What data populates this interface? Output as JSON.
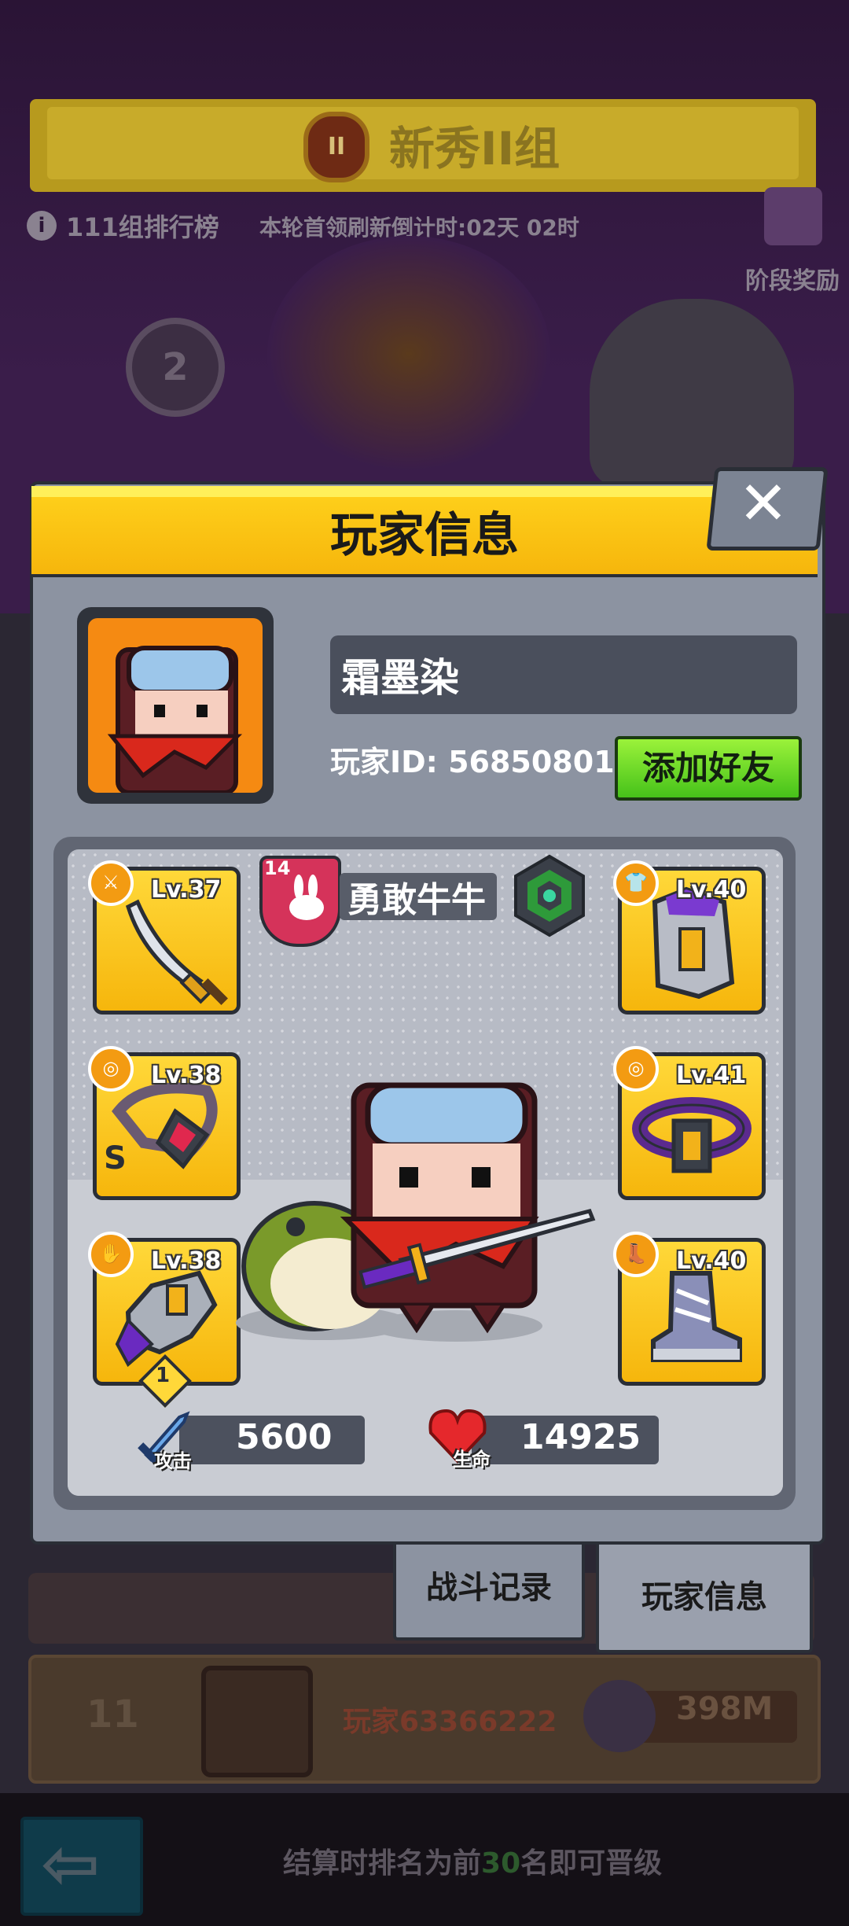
{
  "background": {
    "group_title": "新秀II组",
    "group_rank_badge": "II",
    "rank_list_label": "111组排行榜",
    "countdown": "本轮首领刷新倒计时:02天 02时",
    "stage_reward_label": "阶段奖励",
    "podium_second": "2",
    "row_rank": "11",
    "row_player_name": "玩家63366222",
    "row_power": "398M",
    "promo_prefix": "结算时排名为前",
    "promo_number": "30",
    "promo_suffix": "名即可晋级"
  },
  "modal": {
    "title": "玩家信息",
    "player_name": "霜墨染",
    "player_id_label": "玩家ID: 56850801",
    "add_friend_label": "添加好友",
    "title_badge_level": "14",
    "player_title": "勇敢牛牛",
    "equipment": {
      "weapon_level": "Lv.37",
      "armor_level": "Lv.40",
      "necklace_level": "Lv.38",
      "necklace_grade": "S",
      "belt_level": "Lv.41",
      "gloves_level": "Lv.38",
      "gloves_star": "1",
      "boots_level": "Lv.40"
    },
    "stats": {
      "attack_label": "攻击",
      "attack_value": "5600",
      "hp_label": "生命",
      "hp_value": "14925"
    }
  },
  "tabs": {
    "battle_record": "战斗记录",
    "player_info": "玩家信息"
  },
  "colors": {
    "header_yellow": "#f6b60c",
    "add_friend_green": "#46c21a",
    "slot_yellow": "#ffd839",
    "panel_gray": "#8c93a1",
    "title_badge_pink": "#d5335a"
  }
}
